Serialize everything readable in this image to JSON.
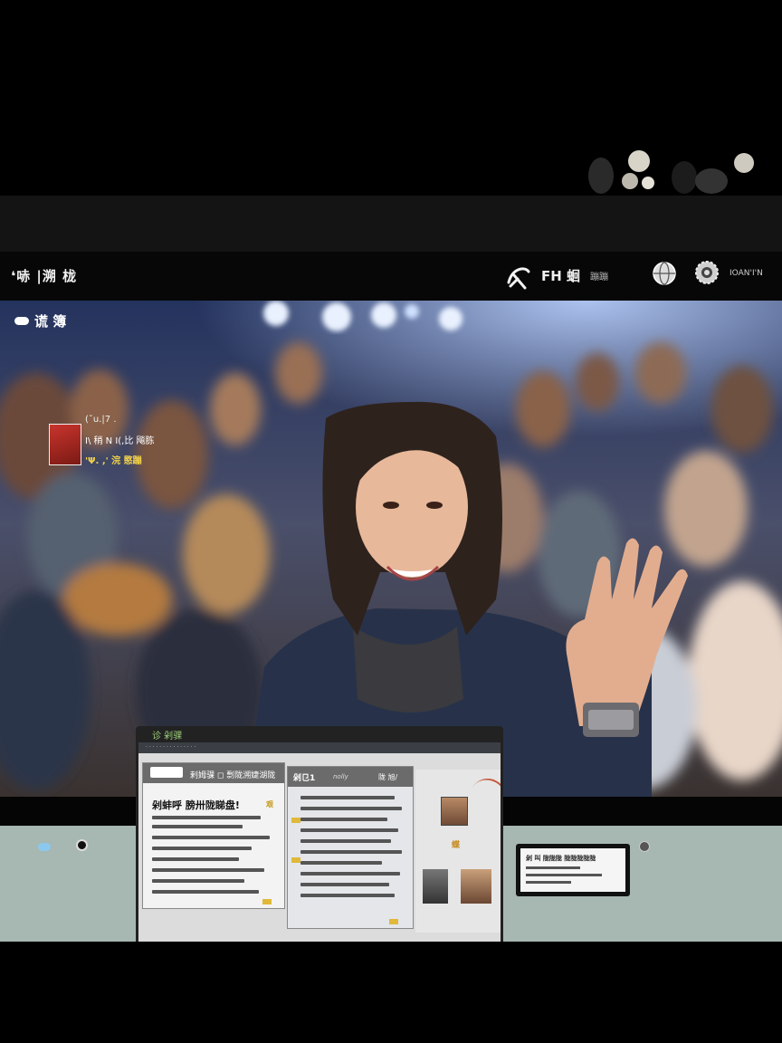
{
  "header": {
    "title": "❛哧 |溯 栊",
    "brand_text": "FH 蛔",
    "brand_small": "蹦蹦",
    "menu_text": "IOAN'I'N"
  },
  "stage": {
    "live_label": "谎 簿",
    "info_card": {
      "line1": "(ˇu.|7 .",
      "line2": "I\\ 稍 N I(,比 飚胨",
      "line3": "'Ψ. ,' 浣 愍蹦"
    }
  },
  "laptop": {
    "title": "诊 剁骒",
    "panel1_header": "剌姆骒 ◻ 剽陇溯婕湖陇",
    "panel1_title": "剁蚌呼 膀卅陇睇盘!",
    "panel1_tag": "艰",
    "panel2_header": "剁㔾1",
    "panel2_sub": "nolly",
    "panel2_badge": "陇 旭/",
    "panel3_badge": "蝶"
  },
  "tablet": {
    "line1": "剁 叫 陇陇陇 陇陇陇陇陇"
  },
  "colors": {
    "tray": "#a7b7b1",
    "accent_yellow": "#e0b93a",
    "header_bg": "#070707"
  }
}
